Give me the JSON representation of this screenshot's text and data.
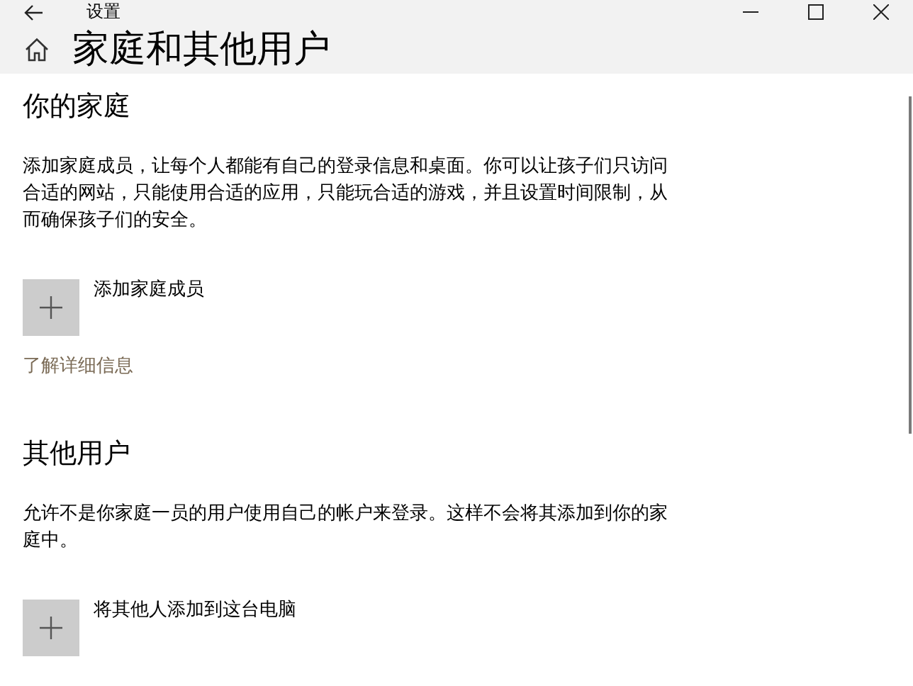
{
  "window": {
    "title": "设置"
  },
  "page": {
    "title": "家庭和其他用户"
  },
  "sections": [
    {
      "heading": "你的家庭",
      "description": "添加家庭成员，让每个人都能有自己的登录信息和桌面。你可以让孩子们只访问合适的网站，只能使用合适的应用，只能玩合适的游戏，并且设置时间限制，从而确保孩子们的安全。",
      "action": "添加家庭成员",
      "link": "了解详细信息"
    },
    {
      "heading": "其他用户",
      "description": "允许不是你家庭一员的用户使用自己的帐户来登录。这样不会将其添加到你的家庭中。",
      "action": "将其他人添加到这台电脑"
    }
  ]
}
